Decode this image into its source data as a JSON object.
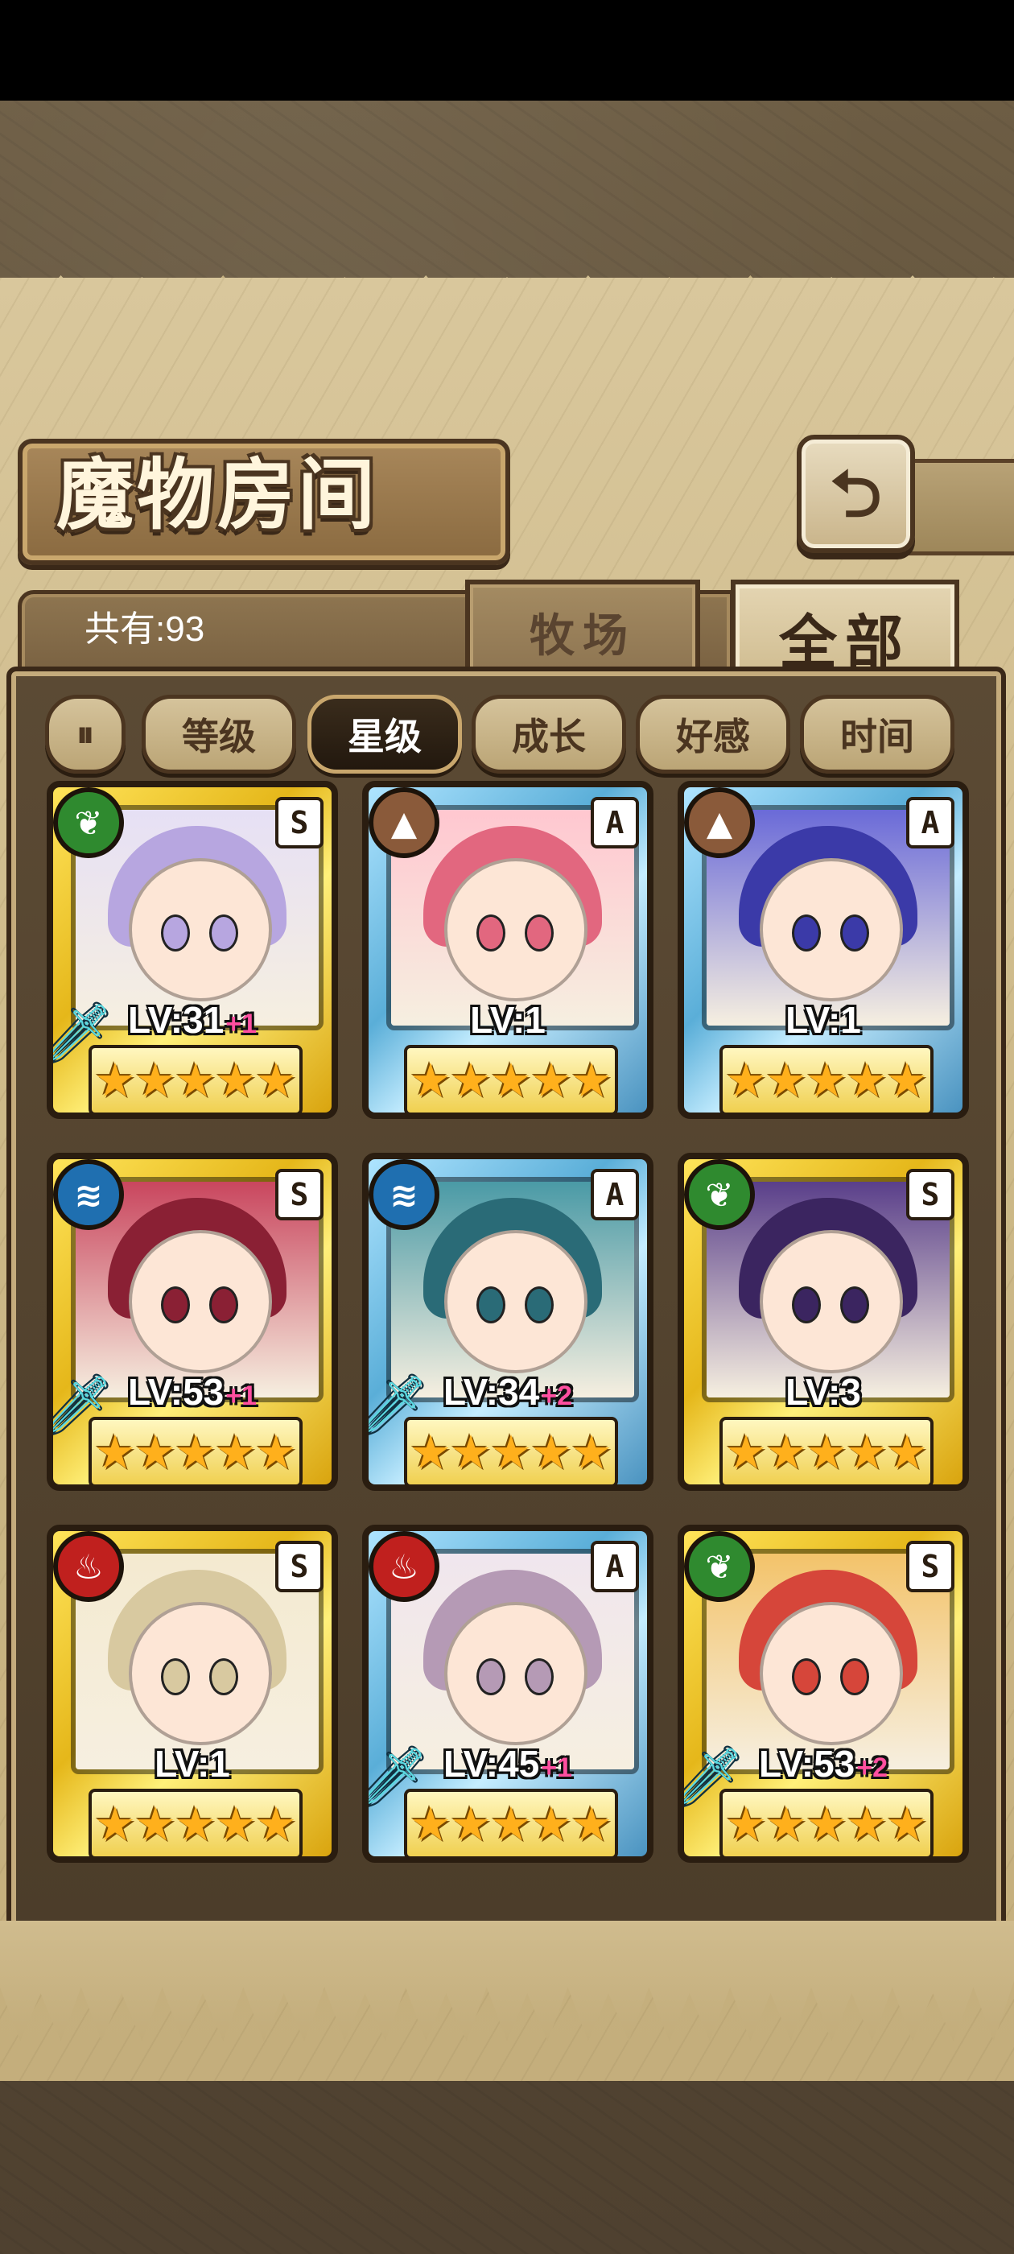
{
  "header": {
    "title": "魔物房间",
    "back_icon": "return-arrow-icon"
  },
  "summary": {
    "count_label": "共有:93"
  },
  "tabs": [
    {
      "label": "牧场",
      "selected": false
    },
    {
      "label": "全部",
      "selected": true
    }
  ],
  "sort_toggle_icon": "sort-order-icon",
  "filters": [
    {
      "label": "等级",
      "active": false
    },
    {
      "label": "星级",
      "active": true
    },
    {
      "label": "成长",
      "active": false
    },
    {
      "label": "好感",
      "active": false
    },
    {
      "label": "时间",
      "active": false
    }
  ],
  "monsters": [
    {
      "rank": "S",
      "element": "leaf",
      "level": "LV:31",
      "bonus": "+1",
      "weapon": true,
      "stars": 5
    },
    {
      "rank": "A",
      "element": "earth",
      "level": "LV:1",
      "bonus": "",
      "weapon": false,
      "stars": 5
    },
    {
      "rank": "A",
      "element": "earth",
      "level": "LV:1",
      "bonus": "",
      "weapon": false,
      "stars": 5
    },
    {
      "rank": "S",
      "element": "water",
      "level": "LV:53",
      "bonus": "+1",
      "weapon": true,
      "stars": 5
    },
    {
      "rank": "A",
      "element": "water",
      "level": "LV:34",
      "bonus": "+2",
      "weapon": true,
      "stars": 5
    },
    {
      "rank": "S",
      "element": "leaf",
      "level": "LV:3",
      "bonus": "",
      "weapon": false,
      "stars": 5
    },
    {
      "rank": "S",
      "element": "fire",
      "level": "LV:1",
      "bonus": "",
      "weapon": false,
      "stars": 5
    },
    {
      "rank": "A",
      "element": "fire",
      "level": "LV:45",
      "bonus": "+1",
      "weapon": true,
      "stars": 5
    },
    {
      "rank": "S",
      "element": "leaf",
      "level": "LV:53",
      "bonus": "+2",
      "weapon": true,
      "stars": 5
    }
  ],
  "colors": {
    "leaf": "#2f8a2f",
    "earth": "#8a5a3a",
    "water": "#1f6fb0",
    "fire": "#c0201e",
    "level_bonus": "#ff4fa0"
  }
}
